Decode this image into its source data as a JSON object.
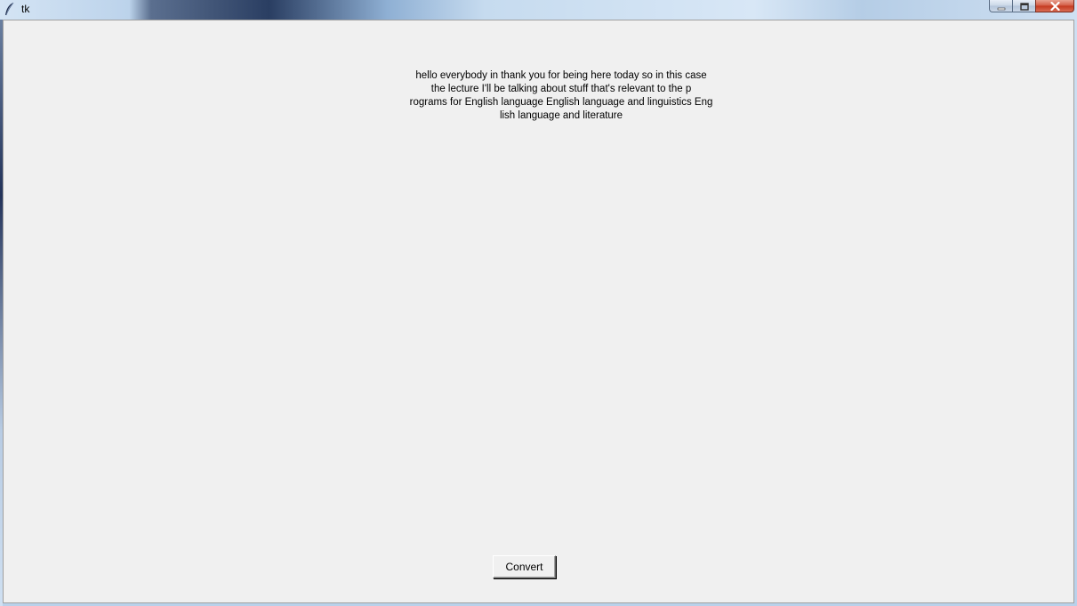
{
  "window": {
    "title": "tk",
    "controls": {
      "minimize": "minimize-icon",
      "maximize": "maximize-icon",
      "close": "close-icon"
    }
  },
  "transcript": {
    "lines": [
      "hello everybody in thank you for being here today so in this case",
      "the lecture I'll be talking about stuff that's relevant to the p",
      "rograms for English language English language and linguistics Eng",
      "lish language and literature"
    ]
  },
  "actions": {
    "convert_label": "Convert"
  },
  "colors": {
    "client_bg": "#f0f0f0",
    "text": "#000000",
    "close_button": "#c3381e"
  }
}
